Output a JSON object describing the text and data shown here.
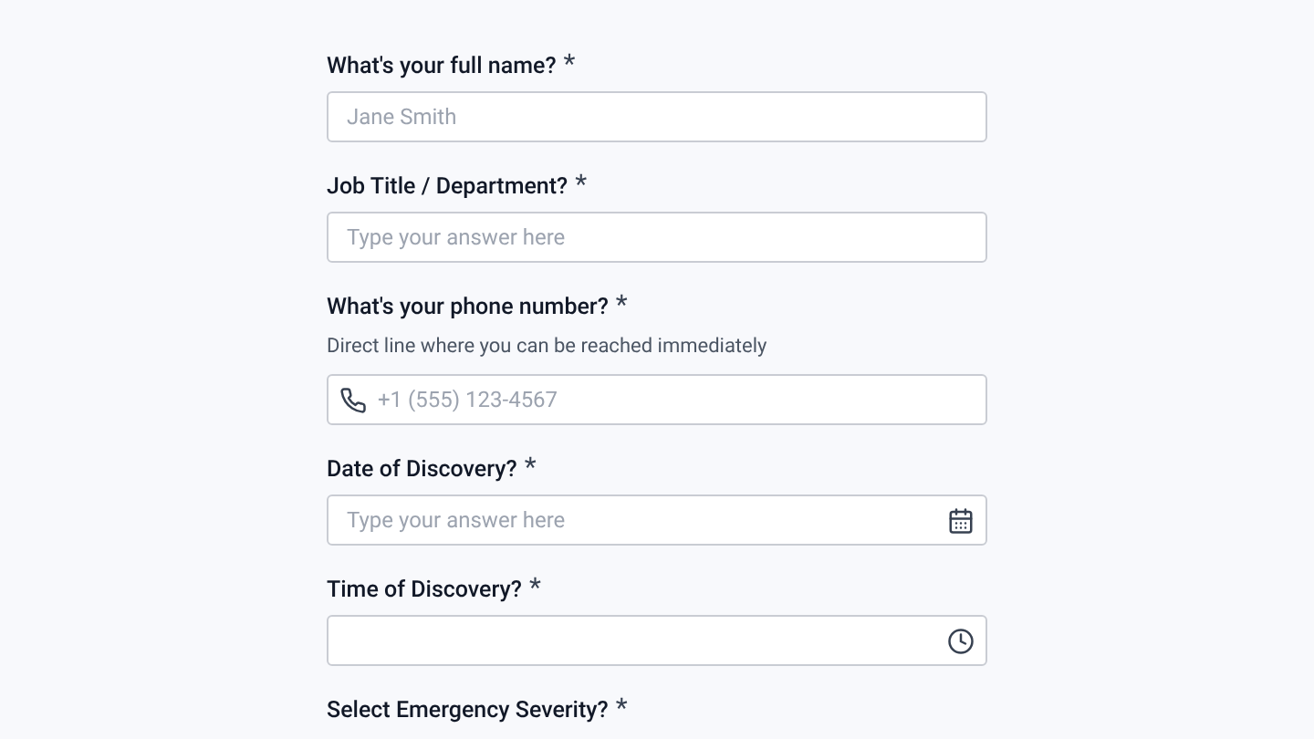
{
  "questions": [
    {
      "kind": "text",
      "label": "What's your full name?",
      "asterisk": "*",
      "placeholder": "Jane Smith"
    },
    {
      "kind": "text",
      "label": "Job Title / Department?",
      "asterisk": "*",
      "placeholder": "Type your answer here"
    },
    {
      "kind": "phone",
      "label": "What's your phone number?",
      "asterisk": "*",
      "hint": "Direct line where you can be reached immediately",
      "placeholder": "+1 (555) 123-4567"
    },
    {
      "kind": "date",
      "label": "Date of Discovery?",
      "asterisk": "*",
      "placeholder": "Type your answer here"
    },
    {
      "kind": "time",
      "label": "Time of Discovery?",
      "asterisk": "*"
    },
    {
      "kind": "choice",
      "label": "Select Emergency Severity?",
      "asterisk": "*"
    }
  ]
}
